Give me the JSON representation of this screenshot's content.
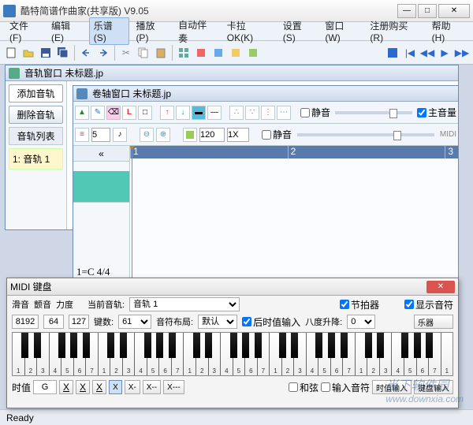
{
  "app": {
    "title": "酷特简谱作曲家(共享版) V9.05"
  },
  "menu": {
    "file": "文件(F)",
    "edit": "编辑(E)",
    "score": "乐谱(S)",
    "play": "播放(P)",
    "accomp": "自动伴奏",
    "kara": "卡拉OK(K)",
    "settings": "设置(S)",
    "window": "窗口(W)",
    "register": "注册购买(R)",
    "help": "帮助(H)"
  },
  "trackwin": {
    "title": "音轨窗口  未标题.jp",
    "add": "添加音轨",
    "del": "删除音轨",
    "list": "音轨列表",
    "track1": "1: 音轨 1"
  },
  "rollwin": {
    "title": "卷轴窗口  未标题.jp",
    "mute": "静音",
    "master": "主音量",
    "midi": "MIDI",
    "t2": {
      "num1": "5",
      "loop": "120",
      "speed": "1X"
    },
    "ruler": {
      "m1": "1",
      "m2": "2",
      "m3": "3"
    },
    "sig": "1=C  4/4",
    "rewind": "«"
  },
  "midiwin": {
    "title": "MIDI 键盘",
    "porta": "滑音",
    "vib": "颤音",
    "vel": "力度",
    "curtrack": "当前音轨:",
    "track_val": "音轨 1",
    "metronome": "节拍器",
    "shownote": "显示音符",
    "v_pitch": "8192",
    "v_vib": "64",
    "v_vel": "127",
    "keys": "键数:",
    "keys_val": "61",
    "layout": "音符布局:",
    "layout_val": "默认",
    "after": "后时值输入",
    "octave": "八度升降:",
    "octave_val": "0",
    "instrument": "乐器",
    "dur_label": "时值",
    "dur_val": "G",
    "chord": "和弦",
    "inputnote": "输入音符",
    "durinput": "时值输入",
    "kbdinput": "键盘输入"
  },
  "status": {
    "ready": "Ready"
  },
  "watermark": {
    "cn": "当下软件园",
    "en": "www.downxia.com"
  },
  "chart_data": {
    "type": "table",
    "description": "Piano keyboard note numbers (simplified numeric notation)",
    "white_key_labels": [
      "1",
      "2",
      "3",
      "4",
      "5",
      "6",
      "7",
      "1",
      "2",
      "3",
      "4",
      "5",
      "6",
      "7",
      "1",
      "2",
      "3",
      "4",
      "5",
      "6",
      "7",
      "1",
      "2",
      "3",
      "4",
      "5",
      "6",
      "7",
      "1",
      "2",
      "3",
      "4",
      "5",
      "6",
      "7",
      "1"
    ],
    "octaves": 5,
    "keys_total": 61
  }
}
